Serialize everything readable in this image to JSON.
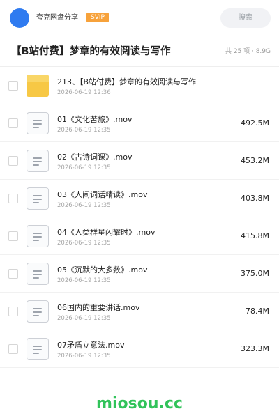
{
  "header": {
    "username": "夸克网盘分享",
    "badge": "SVIP",
    "search_label": "搜索",
    "avatar_color": "#2f7bf0"
  },
  "folder": {
    "title": "【B站付费】梦章的有效阅读与写作",
    "meta": "共 25 项 · 8.9G"
  },
  "files": [
    {
      "icon": "folder-icon",
      "name": "213、【B站付费】梦章的有效阅读与写作",
      "date": "2026-06-19 12:36",
      "size": ""
    },
    {
      "icon": "document-icon",
      "name": "01《文化苦旅》.mov",
      "date": "2026-06-19 12:35",
      "size": "492.5M"
    },
    {
      "icon": "document-icon",
      "name": "02《古诗词课》.mov",
      "date": "2026-06-19 12:35",
      "size": "453.2M"
    },
    {
      "icon": "document-icon",
      "name": "03《人间词话精读》.mov",
      "date": "2026-06-19 12:35",
      "size": "403.8M"
    },
    {
      "icon": "document-icon",
      "name": "04《人类群星闪耀时》.mov",
      "date": "2026-06-19 12:35",
      "size": "415.8M"
    },
    {
      "icon": "document-icon",
      "name": "05《沉默的大多数》.mov",
      "date": "2026-06-19 12:35",
      "size": "375.0M"
    },
    {
      "icon": "document-icon",
      "name": "06国内的重要讲话.mov",
      "date": "2026-06-19 12:35",
      "size": "78.4M"
    },
    {
      "icon": "document-icon",
      "name": "07矛盾立意法.mov",
      "date": "2026-06-19 12:35",
      "size": "323.3M"
    }
  ],
  "watermark": "miosou.cc",
  "colors": {
    "accent": "#2f7bf0",
    "svip": "#f7a23b",
    "folder": "#f7c845",
    "watermark": "#31c35a"
  }
}
